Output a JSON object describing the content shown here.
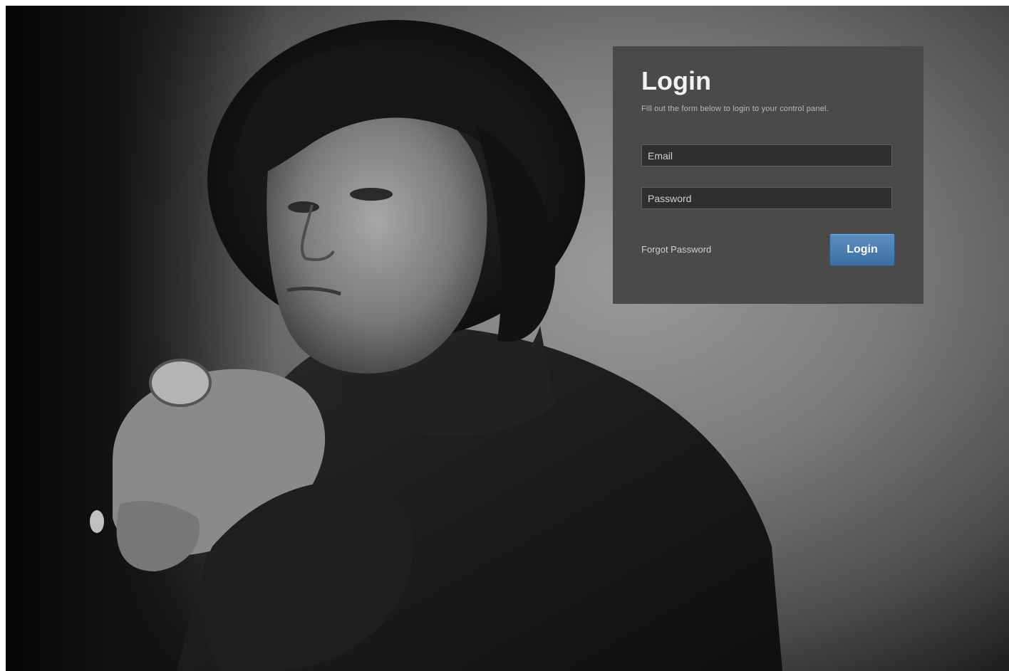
{
  "login": {
    "title": "Login",
    "subtitle": "Fill out the form below to login to your control panel.",
    "email_placeholder": "Email",
    "password_placeholder": "Password",
    "forgot_label": "Forgot Password",
    "submit_label": "Login"
  },
  "colors": {
    "card_background": "#4a4a4a",
    "button_blue": "#4a7db3",
    "field_background": "#2f2f2f"
  }
}
